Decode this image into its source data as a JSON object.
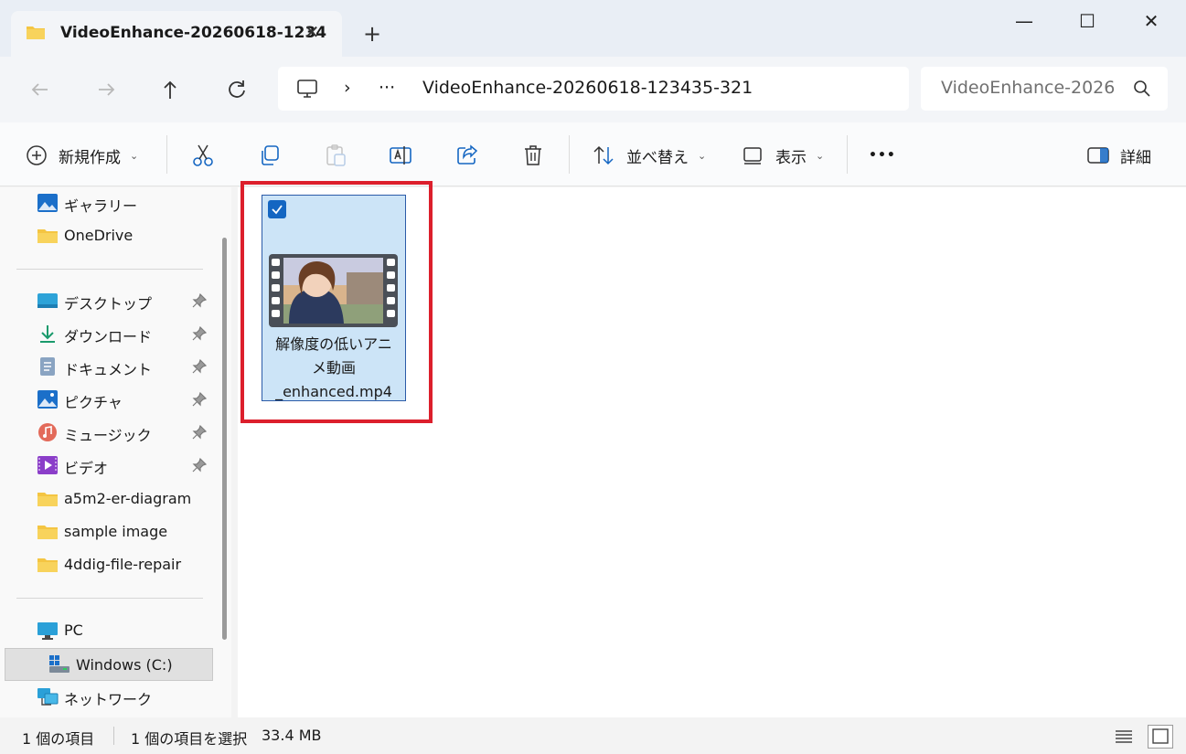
{
  "window": {
    "tab_title": "VideoEnhance-20260618-1234",
    "tab_close_glyph": "✕",
    "new_tab_glyph": "+",
    "controls": {
      "minimize": "—",
      "maximize": "☐",
      "close": "✕"
    }
  },
  "address": {
    "chevron": "›",
    "ellipsis": "···",
    "path": "VideoEnhance-20260618-123435-321",
    "search_placeholder": "VideoEnhance-2026"
  },
  "toolbar": {
    "new_label": "新規作成",
    "sort_label": "並べ替え",
    "view_label": "表示",
    "more_glyph": "•••",
    "details_label": "詳細",
    "caret": "⌄"
  },
  "sidebar": {
    "quick": [
      {
        "label": "ギャラリー",
        "icon": "gallery-icon"
      },
      {
        "label": "OneDrive",
        "icon": "folder-icon"
      }
    ],
    "pinned": [
      {
        "label": "デスクトップ",
        "icon": "desktop-icon"
      },
      {
        "label": "ダウンロード",
        "icon": "download-icon"
      },
      {
        "label": "ドキュメント",
        "icon": "document-icon"
      },
      {
        "label": "ピクチャ",
        "icon": "pictures-icon"
      },
      {
        "label": "ミュージック",
        "icon": "music-icon"
      },
      {
        "label": "ビデオ",
        "icon": "video-icon"
      }
    ],
    "folders": [
      {
        "label": "a5m2-er-diagram"
      },
      {
        "label": "sample image"
      },
      {
        "label": "4ddig-file-repair"
      }
    ],
    "pc_label": "PC",
    "drive_label": "Windows (C:)",
    "network_label": "ネットワーク"
  },
  "content": {
    "file_name_line1": "解像度の低いアニ",
    "file_name_line2": "メ動画",
    "file_name_line3": "_enhanced.mp4",
    "selected": true
  },
  "status": {
    "item_count": "1 個の項目",
    "selection": "1 個の項目を選択",
    "size": "33.4 MB"
  },
  "colors": {
    "accent": "#1466c2",
    "selection_bg": "#cce4f7",
    "highlight": "#dc1f2c",
    "folder_yellow": "#f4c542"
  }
}
